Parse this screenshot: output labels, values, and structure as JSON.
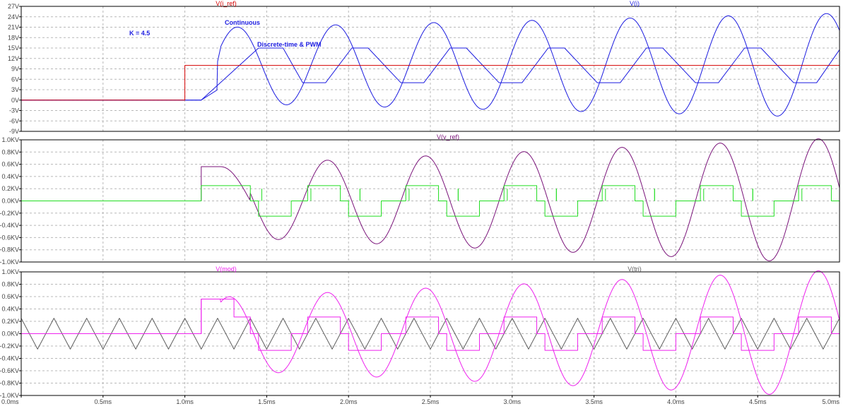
{
  "colors": {
    "background": "#ffffff",
    "grid": "#b8b8b8",
    "frame": "#000000",
    "tick_text": "#444444",
    "red": "#d40000",
    "blue": "#1c1ce0",
    "purple": "#7a137a",
    "green": "#22dd22",
    "magenta": "#ee22ee",
    "gray": "#606060",
    "annotation": "#1c1ce0"
  },
  "chart_data": [
    {
      "type": "line",
      "id": "current",
      "x_unit": "ms",
      "xlim": [
        0,
        5
      ],
      "ylim": [
        -9,
        27
      ],
      "y_ticks": [
        "27V",
        "24V",
        "21V",
        "18V",
        "15V",
        "12V",
        "9V",
        "6V",
        "3V",
        "0V",
        "-3V",
        "-6V",
        "-9V"
      ],
      "traces": [
        {
          "key": "red",
          "name": "V(i_ref)",
          "label_color": "red"
        },
        {
          "key": "blue",
          "name": "V(i)",
          "label_color": "blue"
        }
      ],
      "annotations": [
        "K = 4.5",
        "Continuous",
        "Discrete-time & PWM"
      ],
      "series": {
        "i_ref": {
          "color": "red",
          "points": [
            [
              0,
              0
            ],
            [
              1.0,
              0
            ],
            [
              1.0,
              10
            ],
            [
              5.0,
              10
            ]
          ]
        },
        "i_continuous": {
          "color": "blue",
          "step_ms": 1.0,
          "offset": 10,
          "amp_start": 11,
          "amp_growth": 0.65,
          "period_ms": 0.6,
          "phase_ms": 1.1
        },
        "i_discrete": {
          "color": "blue",
          "points": [
            [
              0,
              0
            ],
            [
              1.1,
              0
            ],
            [
              1.45,
              15
            ],
            [
              1.6,
              15
            ],
            [
              1.72,
              5
            ],
            [
              1.86,
              5
            ],
            [
              2.02,
              15
            ],
            [
              2.12,
              15
            ],
            [
              2.32,
              5
            ],
            [
              2.46,
              5
            ],
            [
              2.62,
              15
            ],
            [
              2.72,
              15
            ],
            [
              2.92,
              5
            ],
            [
              3.06,
              5
            ],
            [
              3.22,
              15
            ],
            [
              3.32,
              15
            ],
            [
              3.52,
              5
            ],
            [
              3.66,
              5
            ],
            [
              3.82,
              15
            ],
            [
              3.92,
              15
            ],
            [
              4.12,
              5
            ],
            [
              4.26,
              5
            ],
            [
              4.42,
              15
            ],
            [
              4.52,
              15
            ],
            [
              4.72,
              5
            ],
            [
              4.86,
              5
            ],
            [
              5.0,
              14.5
            ]
          ]
        }
      }
    },
    {
      "type": "line",
      "id": "voltage",
      "x_unit": "ms",
      "xlim": [
        0,
        5
      ],
      "ylim": [
        -1.0,
        1.0
      ],
      "y_unit": "KV",
      "y_ticks": [
        "1.0KV",
        "0.8KV",
        "0.6KV",
        "0.4KV",
        "0.2KV",
        "0.0KV",
        "-0.2KV",
        "-0.4KV",
        "-0.6KV",
        "-0.8KV",
        "-1.0KV"
      ],
      "traces": [
        {
          "key": "purple",
          "name": "V(v_ref)",
          "label_color": "purple"
        }
      ],
      "series": {
        "v_ref": {
          "color": "purple",
          "hold_until_ms": 1.1,
          "hold_level": 0.56,
          "amp_start": 0.6,
          "amp_growth": 0.07,
          "period_ms": 0.6
        },
        "v_pwm": {
          "color": "green",
          "levels": [
            0.25,
            0,
            -0.25
          ]
        }
      }
    },
    {
      "type": "line",
      "id": "modulation",
      "x_unit": "ms",
      "xlim": [
        0,
        5
      ],
      "ylim": [
        -1.0,
        1.0
      ],
      "y_unit": "KV",
      "y_ticks": [
        "1.0KV",
        "0.8KV",
        "0.6KV",
        "0.4KV",
        "0.2KV",
        "0.0KV",
        "-0.2KV",
        "-0.4KV",
        "-0.6KV",
        "-0.8KV",
        "-1.0KV"
      ],
      "x_ticks": [
        "0.0ms",
        "0.5ms",
        "1.0ms",
        "1.5ms",
        "2.0ms",
        "2.5ms",
        "3.0ms",
        "3.5ms",
        "4.0ms",
        "4.5ms",
        "5.0ms"
      ],
      "traces": [
        {
          "key": "magenta",
          "name": "V(mod)",
          "label_color": "magenta"
        },
        {
          "key": "gray",
          "name": "V(tri)",
          "label_color": "gray"
        }
      ],
      "series": {
        "tri": {
          "color": "gray",
          "amplitude": 0.25,
          "period_ms": 0.2
        },
        "mod": {
          "color": "magenta"
        }
      }
    }
  ]
}
